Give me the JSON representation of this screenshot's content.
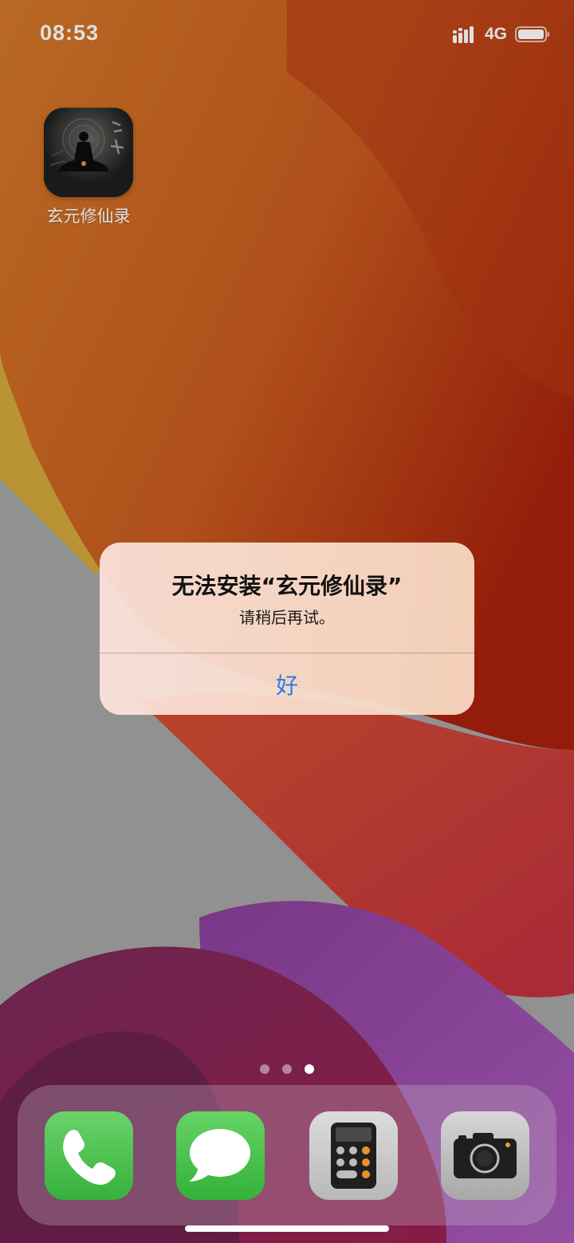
{
  "status_bar": {
    "time": "08:53",
    "network": "4G",
    "icons": [
      "signal-icon",
      "battery-icon"
    ]
  },
  "home_screen": {
    "apps": [
      {
        "label": "玄元修仙录",
        "icon": "xuanyuan-app-icon"
      }
    ],
    "page_indicator": {
      "pages": 3,
      "current": 3
    }
  },
  "alert": {
    "title": "无法安装“玄元修仙录”",
    "message": "请稍后再试。",
    "button_label": "好",
    "button_color": "#2f7be8"
  },
  "dock": {
    "apps": [
      {
        "name": "phone",
        "icon": "phone-icon",
        "color": "#5ac95a"
      },
      {
        "name": "messages",
        "icon": "messages-icon",
        "color": "#4cc84a"
      },
      {
        "name": "calculator",
        "icon": "calculator-icon",
        "color": "#d0d0d0"
      },
      {
        "name": "camera",
        "icon": "camera-icon",
        "color": "#c9c9c9"
      }
    ]
  }
}
